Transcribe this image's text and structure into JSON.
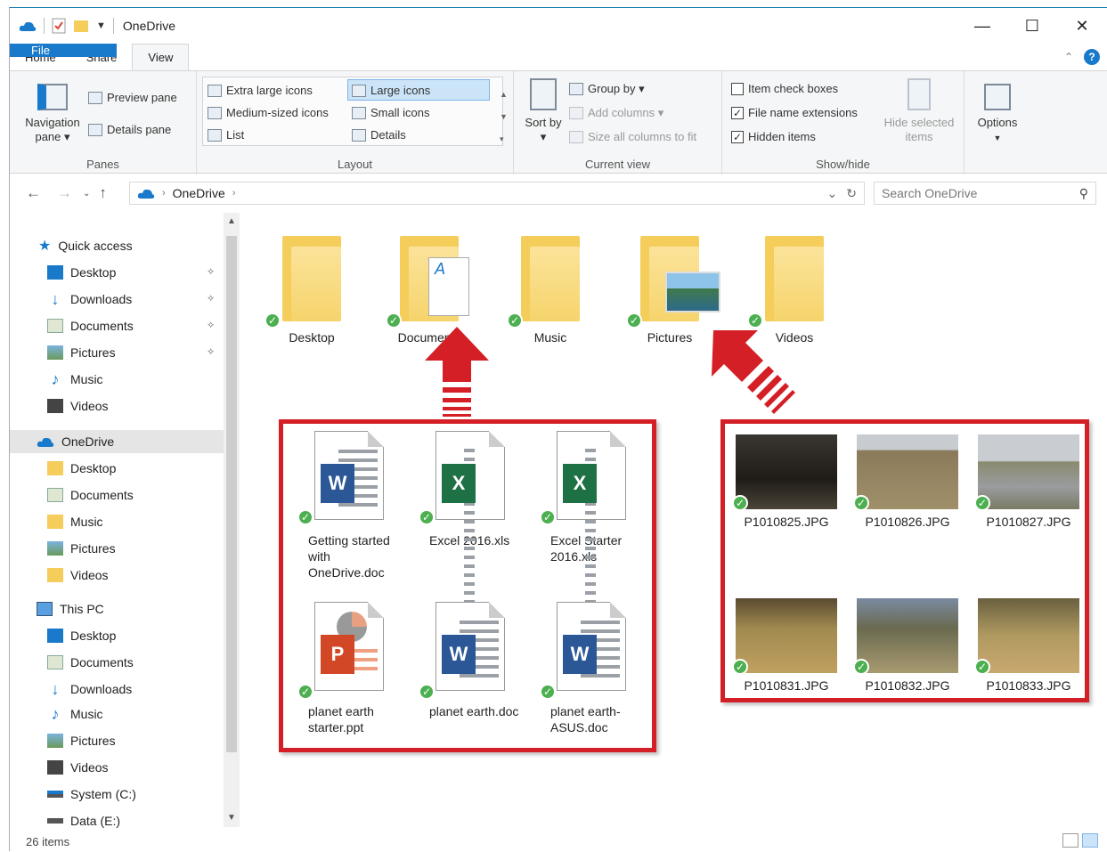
{
  "window": {
    "title": "OneDrive"
  },
  "ribbon_tabs": [
    "File",
    "Home",
    "Share",
    "View"
  ],
  "ribbon": {
    "panes": {
      "label": "Panes",
      "navigation_pane": "Navigation pane ▾",
      "preview_pane": "Preview pane",
      "details_pane": "Details pane"
    },
    "layout": {
      "label": "Layout",
      "extra_large": "Extra large icons",
      "large": "Large icons",
      "medium": "Medium-sized icons",
      "small": "Small icons",
      "list": "List",
      "details": "Details"
    },
    "current_view": {
      "label": "Current view",
      "sort_by": "Sort by ▾",
      "group_by": "Group by ▾",
      "add_columns": "Add columns ▾",
      "size_columns": "Size all columns to fit"
    },
    "show_hide": {
      "label": "Show/hide",
      "item_check_boxes": "Item check boxes",
      "item_check_boxes_checked": false,
      "file_name_extensions": "File name extensions",
      "file_name_extensions_checked": true,
      "hidden_items": "Hidden items",
      "hidden_items_checked": true,
      "hide_selected": "Hide selected items"
    },
    "options": "Options"
  },
  "address": {
    "path": "OneDrive",
    "search_placeholder": "Search OneDrive"
  },
  "nav": {
    "quick_access": "Quick access",
    "quick_items": [
      "Desktop",
      "Downloads",
      "Documents",
      "Pictures",
      "Music",
      "Videos"
    ],
    "onedrive": "OneDrive",
    "onedrive_items": [
      "Desktop",
      "Documents",
      "Music",
      "Pictures",
      "Videos"
    ],
    "this_pc": "This PC",
    "pc_items": [
      "Desktop",
      "Documents",
      "Downloads",
      "Music",
      "Pictures",
      "Videos",
      "System (C:)",
      "Data (E:)"
    ]
  },
  "folders": [
    "Desktop",
    "Documents",
    "Music",
    "Pictures",
    "Videos"
  ],
  "documents_files": [
    {
      "name": "Getting started with OneDrive.doc",
      "type": "W"
    },
    {
      "name": "Excel 2016.xls",
      "type": "X"
    },
    {
      "name": "Excel Starter 2016.xls",
      "type": "X"
    },
    {
      "name": "planet earth starter.ppt",
      "type": "P"
    },
    {
      "name": "planet earth.doc",
      "type": "W"
    },
    {
      "name": "planet earth-ASUS.doc",
      "type": "W"
    }
  ],
  "pictures_files": [
    "P1010825.JPG",
    "P1010826.JPG",
    "P1010827.JPG",
    "P1010831.JPG",
    "P1010832.JPG",
    "P1010833.JPG"
  ],
  "status": {
    "items": "26 items"
  },
  "colors": {
    "accent": "#1979ca",
    "highlight_red": "#d41f26",
    "folder": "#f4cd5b",
    "sync_green": "#4caf50"
  }
}
